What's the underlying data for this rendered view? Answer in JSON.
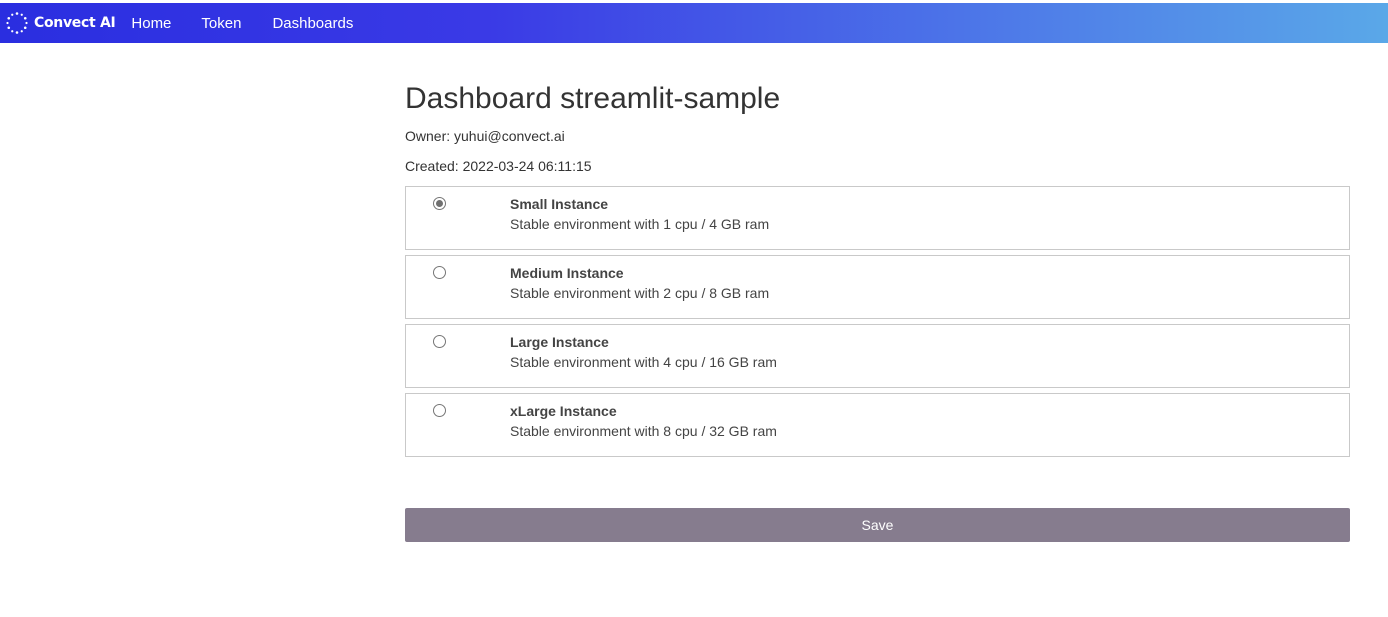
{
  "navbar": {
    "brand": "Convect AI",
    "brand_icon": "dotted-ring-logo-icon",
    "links": [
      {
        "label": "Home"
      },
      {
        "label": "Token"
      },
      {
        "label": "Dashboards"
      }
    ]
  },
  "dashboard": {
    "title": "Dashboard streamlit-sample",
    "owner": "Owner: yuhui@convect.ai",
    "created": "Created: 2022-03-24 06:11:15"
  },
  "instances": {
    "selected": "Small Instance",
    "options": [
      {
        "title": "Small Instance",
        "description": "Stable environment with 1 cpu / 4 GB ram",
        "checked": true
      },
      {
        "title": "Medium Instance",
        "description": "Stable environment with 2 cpu / 8 GB ram",
        "checked": false
      },
      {
        "title": "Large Instance",
        "description": "Stable environment with 4 cpu / 16 GB ram",
        "checked": false
      },
      {
        "title": "xLarge Instance",
        "description": "Stable environment with 8 cpu / 32 GB ram",
        "checked": false
      }
    ]
  },
  "actions": {
    "save_label": "Save"
  },
  "colors": {
    "navbar_gradient_start": "#2a2ee0",
    "navbar_gradient_end": "#5aa8e8",
    "save_button": "#867c8e",
    "option_border": "#c9c9c9"
  }
}
